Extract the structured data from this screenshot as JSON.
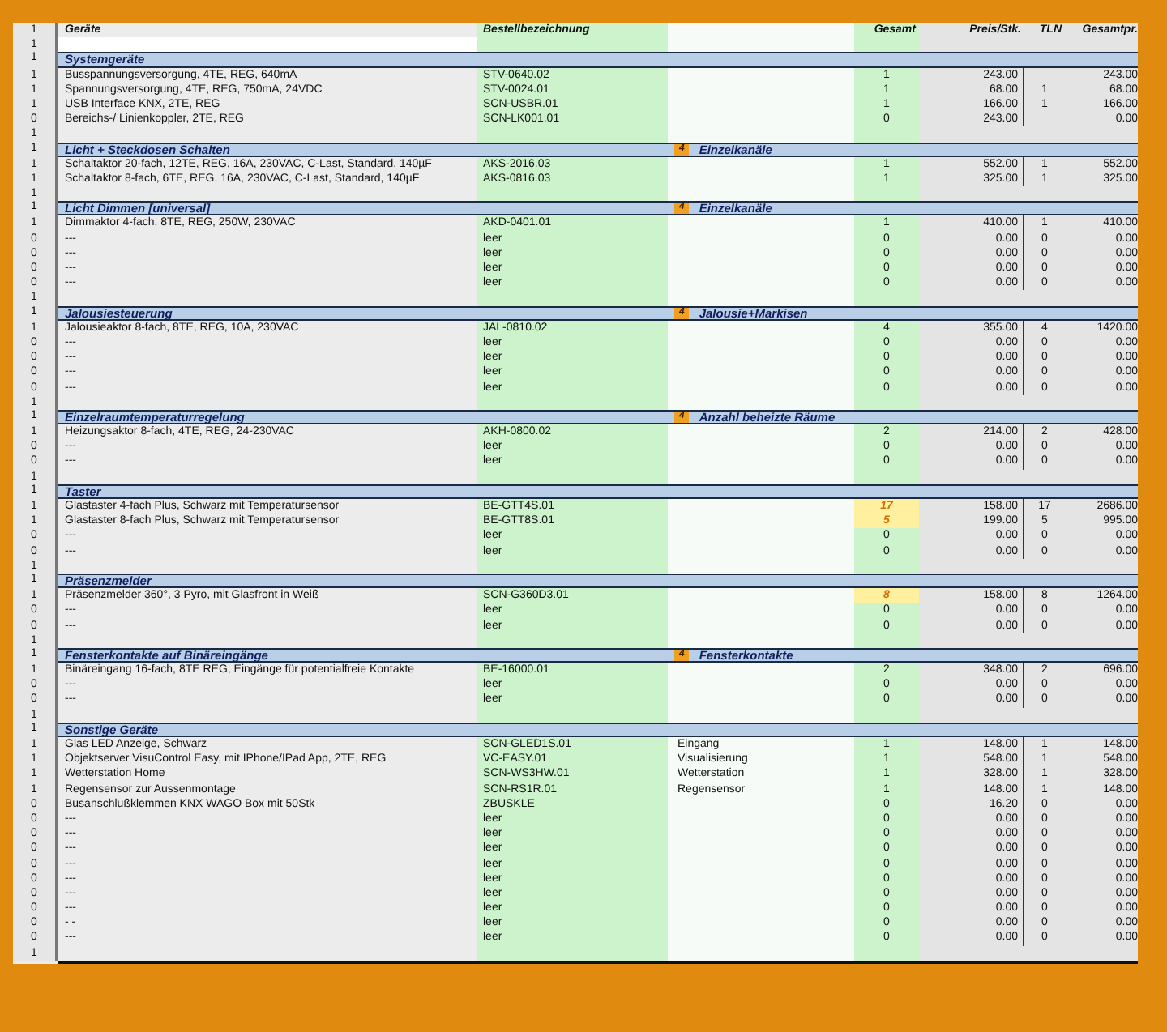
{
  "header": {
    "flag": "1",
    "description": "Geräte",
    "order_no": "Bestellbezeichnung",
    "total": "Gesamt",
    "price": "Preis/Stk.",
    "tln": "TLN",
    "sum": "Gesamtpr."
  },
  "rows": [
    {
      "kind": "blank",
      "flag": "1"
    },
    {
      "kind": "section",
      "flag": "1",
      "title": "Systemgeräte"
    },
    {
      "kind": "item",
      "flag": "1",
      "description": "Busspannungsversorgung, 4TE, REG, 640mA",
      "order_no": "STV-0640.02",
      "total": "1",
      "total_highlighted": false,
      "price": "243.00",
      "sum": "243.00"
    },
    {
      "kind": "item",
      "flag": "1",
      "description": "Spannungsversorgung, 4TE, REG, 750mA, 24VDC",
      "order_no": "STV-0024.01",
      "total": "1",
      "total_highlighted": false,
      "price": "68.00",
      "tln": "1",
      "sum": "68.00"
    },
    {
      "kind": "item",
      "flag": "1",
      "description": "USB Interface KNX, 2TE, REG",
      "order_no": "SCN-USBR.01",
      "total": "1",
      "total_highlighted": false,
      "price": "166.00",
      "tln": "1",
      "sum": "166.00"
    },
    {
      "kind": "item",
      "flag": "0",
      "description": "Bereichs-/ Linienkoppler, 2TE, REG",
      "order_no": "SCN-LK001.01",
      "total": "0",
      "total_highlighted": false,
      "price": "243.00",
      "sum": "0.00"
    },
    {
      "kind": "blank",
      "flag": "1"
    },
    {
      "kind": "section",
      "flag": "1",
      "title": "Licht + Steckdosen Schalten",
      "badge": "4",
      "badge_label": "Einzelkanäle"
    },
    {
      "kind": "item",
      "flag": "1",
      "description": "Schaltaktor 20-fach, 12TE, REG, 16A, 230VAC, C-Last, Standard, 140µF",
      "order_no": "AKS-2016.03",
      "total": "1",
      "total_highlighted": false,
      "price": "552.00",
      "tln": "1",
      "sum": "552.00"
    },
    {
      "kind": "item",
      "flag": "1",
      "description": "Schaltaktor 8-fach, 6TE, REG, 16A, 230VAC, C-Last, Standard, 140µF",
      "order_no": "AKS-0816.03",
      "total": "1",
      "total_highlighted": false,
      "price": "325.00",
      "tln": "1",
      "sum": "325.00"
    },
    {
      "kind": "blank",
      "flag": "1"
    },
    {
      "kind": "section",
      "flag": "1",
      "title": "Licht Dimmen [universal]",
      "badge": "4",
      "badge_label": "Einzelkanäle"
    },
    {
      "kind": "item",
      "flag": "1",
      "description": "Dimmaktor 4-fach, 8TE, REG, 250W, 230VAC",
      "order_no": "AKD-0401.01",
      "total": "1",
      "total_highlighted": false,
      "price": "410.00",
      "tln": "1",
      "sum": "410.00"
    },
    {
      "kind": "item",
      "flag": "0",
      "description": "---",
      "order_no": "leer",
      "total": "0",
      "total_highlighted": false,
      "price": "0.00",
      "tln": "0",
      "sum": "0.00"
    },
    {
      "kind": "item",
      "flag": "0",
      "description": "---",
      "order_no": "leer",
      "total": "0",
      "total_highlighted": false,
      "price": "0.00",
      "tln": "0",
      "sum": "0.00"
    },
    {
      "kind": "item",
      "flag": "0",
      "description": "---",
      "order_no": "leer",
      "total": "0",
      "total_highlighted": false,
      "price": "0.00",
      "tln": "0",
      "sum": "0.00"
    },
    {
      "kind": "item",
      "flag": "0",
      "description": "---",
      "order_no": "leer",
      "total": "0",
      "total_highlighted": false,
      "price": "0.00",
      "tln": "0",
      "sum": "0.00"
    },
    {
      "kind": "blank",
      "flag": "1"
    },
    {
      "kind": "section",
      "flag": "1",
      "title": "Jalousiesteuerung",
      "badge": "4",
      "badge_label": "Jalousie+Markisen"
    },
    {
      "kind": "item",
      "flag": "1",
      "description": "Jalousieaktor 8-fach, 8TE, REG, 10A, 230VAC",
      "order_no": "JAL-0810.02",
      "total": "4",
      "total_highlighted": false,
      "price": "355.00",
      "tln": "4",
      "sum": "1420.00"
    },
    {
      "kind": "item",
      "flag": "0",
      "description": "---",
      "order_no": "leer",
      "total": "0",
      "total_highlighted": false,
      "price": "0.00",
      "tln": "0",
      "sum": "0.00"
    },
    {
      "kind": "item",
      "flag": "0",
      "description": "---",
      "order_no": "leer",
      "total": "0",
      "total_highlighted": false,
      "price": "0.00",
      "tln": "0",
      "sum": "0.00"
    },
    {
      "kind": "item",
      "flag": "0",
      "description": "---",
      "order_no": "leer",
      "total": "0",
      "total_highlighted": false,
      "price": "0.00",
      "tln": "0",
      "sum": "0.00"
    },
    {
      "kind": "item",
      "flag": "0",
      "description": "---",
      "order_no": "leer",
      "total": "0",
      "total_highlighted": false,
      "price": "0.00",
      "tln": "0",
      "sum": "0.00"
    },
    {
      "kind": "blank",
      "flag": "1"
    },
    {
      "kind": "section",
      "flag": "1",
      "title": "Einzelraumtemperaturregelung",
      "badge": "4",
      "badge_label": "Anzahl beheizte Räume"
    },
    {
      "kind": "item",
      "flag": "1",
      "description": "Heizungsaktor 8-fach, 4TE, REG, 24-230VAC",
      "order_no": "AKH-0800.02",
      "total": "2",
      "total_highlighted": false,
      "price": "214.00",
      "tln": "2",
      "sum": "428.00"
    },
    {
      "kind": "item",
      "flag": "0",
      "description": "---",
      "order_no": "leer",
      "total": "0",
      "total_highlighted": false,
      "price": "0.00",
      "tln": "0",
      "sum": "0.00"
    },
    {
      "kind": "item",
      "flag": "0",
      "description": "---",
      "order_no": "leer",
      "total": "0",
      "total_highlighted": false,
      "price": "0.00",
      "tln": "0",
      "sum": "0.00"
    },
    {
      "kind": "blank",
      "flag": "1"
    },
    {
      "kind": "section",
      "flag": "1",
      "title": "Taster"
    },
    {
      "kind": "item",
      "flag": "1",
      "description": "Glastaster 4-fach Plus, Schwarz mit Temperatursensor",
      "order_no": "BE-GTT4S.01",
      "total": "17",
      "total_highlighted": true,
      "price": "158.00",
      "tln": "17",
      "sum": "2686.00"
    },
    {
      "kind": "item",
      "flag": "1",
      "description": "Glastaster 8-fach Plus, Schwarz mit Temperatursensor",
      "order_no": "BE-GTT8S.01",
      "total": "5",
      "total_highlighted": true,
      "price": "199.00",
      "tln": "5",
      "sum": "995.00"
    },
    {
      "kind": "item",
      "flag": "0",
      "description": "---",
      "order_no": "leer",
      "total": "0",
      "total_highlighted": false,
      "price": "0.00",
      "tln": "0",
      "sum": "0.00"
    },
    {
      "kind": "item",
      "flag": "0",
      "description": "---",
      "order_no": "leer",
      "total": "0",
      "total_highlighted": false,
      "price": "0.00",
      "tln": "0",
      "sum": "0.00"
    },
    {
      "kind": "blank",
      "flag": "1"
    },
    {
      "kind": "section",
      "flag": "1",
      "title": "Präsenzmelder"
    },
    {
      "kind": "item",
      "flag": "1",
      "description": "Präsenzmelder 360°, 3 Pyro, mit Glasfront in Weiß",
      "order_no": "SCN-G360D3.01",
      "total": "8",
      "total_highlighted": true,
      "price": "158.00",
      "tln": "8",
      "sum": "1264.00"
    },
    {
      "kind": "item",
      "flag": "0",
      "description": "---",
      "order_no": "leer",
      "total": "0",
      "total_highlighted": false,
      "price": "0.00",
      "tln": "0",
      "sum": "0.00"
    },
    {
      "kind": "item",
      "flag": "0",
      "description": "---",
      "order_no": "leer",
      "total": "0",
      "total_highlighted": false,
      "price": "0.00",
      "tln": "0",
      "sum": "0.00"
    },
    {
      "kind": "blank",
      "flag": "1"
    },
    {
      "kind": "section",
      "flag": "1",
      "title": "Fensterkontakte auf Binäreingänge",
      "badge": "4",
      "badge_label": "Fensterkontakte"
    },
    {
      "kind": "item",
      "flag": "1",
      "description": "Binäreingang 16-fach, 8TE REG, Eingänge für potentialfreie Kontakte",
      "order_no": "BE-16000.01",
      "total": "2",
      "total_highlighted": false,
      "price": "348.00",
      "tln": "2",
      "sum": "696.00"
    },
    {
      "kind": "item",
      "flag": "0",
      "description": "---",
      "order_no": "leer",
      "total": "0",
      "total_highlighted": false,
      "price": "0.00",
      "tln": "0",
      "sum": "0.00"
    },
    {
      "kind": "item",
      "flag": "0",
      "description": "---",
      "order_no": "leer",
      "total": "0",
      "total_highlighted": false,
      "price": "0.00",
      "tln": "0",
      "sum": "0.00"
    },
    {
      "kind": "blank",
      "flag": "1"
    },
    {
      "kind": "section",
      "flag": "1",
      "title": "Sonstige Geräte"
    },
    {
      "kind": "item",
      "flag": "1",
      "description": "Glas LED Anzeige, Schwarz",
      "order_no": "SCN-GLED1S.01",
      "comment": "Eingang",
      "total": "1",
      "total_highlighted": false,
      "price": "148.00",
      "tln": "1",
      "sum": "148.00"
    },
    {
      "kind": "item",
      "flag": "1",
      "description": "Objektserver VisuControl Easy, mit IPhone/IPad App, 2TE,  REG",
      "order_no": "VC-EASY.01",
      "comment": "Visualisierung",
      "total": "1",
      "total_highlighted": false,
      "price": "548.00",
      "tln": "1",
      "sum": "548.00"
    },
    {
      "kind": "item",
      "flag": "1",
      "description": "Wetterstation Home",
      "order_no": "SCN-WS3HW.01",
      "comment": "Wetterstation",
      "total": "1",
      "total_highlighted": false,
      "price": "328.00",
      "tln": "1",
      "sum": "328.00"
    },
    {
      "kind": "item",
      "flag": "1",
      "description": "Regensensor zur Aussenmontage",
      "order_no": "SCN-RS1R.01",
      "comment": "Regensensor",
      "total": "1",
      "total_highlighted": false,
      "price": "148.00",
      "tln": "1",
      "sum": "148.00"
    },
    {
      "kind": "item",
      "flag": "0",
      "description": "Busanschlußklemmen KNX WAGO Box mit 50Stk",
      "order_no": "ZBUSKLE",
      "total": "0",
      "total_highlighted": false,
      "price": "16.20",
      "tln": "0",
      "sum": "0.00"
    },
    {
      "kind": "item",
      "flag": "0",
      "description": "---",
      "order_no": "leer",
      "total": "0",
      "total_highlighted": false,
      "price": "0.00",
      "tln": "0",
      "sum": "0.00"
    },
    {
      "kind": "item",
      "flag": "0",
      "description": "---",
      "order_no": "leer",
      "total": "0",
      "total_highlighted": false,
      "price": "0.00",
      "tln": "0",
      "sum": "0.00"
    },
    {
      "kind": "item",
      "flag": "0",
      "description": "---",
      "order_no": "leer",
      "total": "0",
      "total_highlighted": false,
      "price": "0.00",
      "tln": "0",
      "sum": "0.00"
    },
    {
      "kind": "item",
      "flag": "0",
      "description": "---",
      "order_no": "leer",
      "total": "0",
      "total_highlighted": false,
      "price": "0.00",
      "tln": "0",
      "sum": "0.00"
    },
    {
      "kind": "item",
      "flag": "0",
      "description": "---",
      "order_no": "leer",
      "total": "0",
      "total_highlighted": false,
      "price": "0.00",
      "tln": "0",
      "sum": "0.00"
    },
    {
      "kind": "item",
      "flag": "0",
      "description": "---",
      "order_no": "leer",
      "total": "0",
      "total_highlighted": false,
      "price": "0.00",
      "tln": "0",
      "sum": "0.00"
    },
    {
      "kind": "item",
      "flag": "0",
      "description": "---",
      "order_no": "leer",
      "total": "0",
      "total_highlighted": false,
      "price": "0.00",
      "tln": "0",
      "sum": "0.00"
    },
    {
      "kind": "item",
      "flag": "0",
      "description": "- -",
      "order_no": "leer",
      "total": "0",
      "total_highlighted": false,
      "price": "0.00",
      "tln": "0",
      "sum": "0.00"
    },
    {
      "kind": "item",
      "flag": "0",
      "description": "---",
      "order_no": "leer",
      "total": "0",
      "total_highlighted": false,
      "price": "0.00",
      "tln": "0",
      "sum": "0.00"
    },
    {
      "kind": "blank",
      "flag": "1"
    }
  ]
}
